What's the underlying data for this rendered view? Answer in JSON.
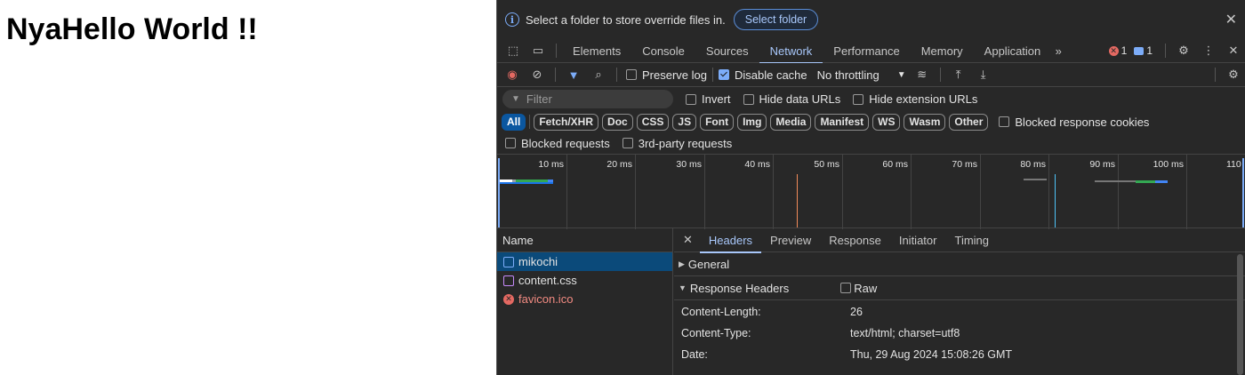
{
  "page": {
    "heading": "NyaHello World !!"
  },
  "banner": {
    "text": "Select a folder to store override files in.",
    "button": "Select folder"
  },
  "tabs": [
    "Elements",
    "Console",
    "Sources",
    "Network",
    "Performance",
    "Memory",
    "Application"
  ],
  "active_tab": "Network",
  "counts": {
    "errors": "1",
    "messages": "1"
  },
  "toolbar": {
    "preserve_log": "Preserve log",
    "disable_cache": "Disable cache",
    "throttling": "No throttling"
  },
  "filter": {
    "placeholder": "Filter",
    "invert": "Invert",
    "hide_data_urls": "Hide data URLs",
    "hide_extension_urls": "Hide extension URLs"
  },
  "type_chips": [
    "All",
    "Fetch/XHR",
    "Doc",
    "CSS",
    "JS",
    "Font",
    "Img",
    "Media",
    "Manifest",
    "WS",
    "Wasm",
    "Other"
  ],
  "blocked_response_cookies": "Blocked response cookies",
  "blocked_requests": "Blocked requests",
  "third_party": "3rd-party requests",
  "timeline": {
    "ticks": [
      "10 ms",
      "20 ms",
      "30 ms",
      "40 ms",
      "50 ms",
      "60 ms",
      "70 ms",
      "80 ms",
      "90 ms",
      "100 ms",
      "110"
    ]
  },
  "requests": {
    "header": "Name",
    "items": [
      {
        "name": "mikochi",
        "kind": "doc"
      },
      {
        "name": "content.css",
        "kind": "css"
      },
      {
        "name": "favicon.ico",
        "kind": "error"
      }
    ]
  },
  "detail": {
    "tabs": [
      "Headers",
      "Preview",
      "Response",
      "Initiator",
      "Timing"
    ],
    "general": "General",
    "response_headers": "Response Headers",
    "raw": "Raw",
    "headers": [
      {
        "key": "Content-Length:",
        "value": "26"
      },
      {
        "key": "Content-Type:",
        "value": "text/html; charset=utf8"
      },
      {
        "key": "Date:",
        "value": "Thu, 29 Aug 2024 15:08:26 GMT"
      }
    ]
  },
  "colors": {
    "accent": "#a8c7fa",
    "selected_row": "#0b4a7a",
    "error": "#e46962"
  }
}
